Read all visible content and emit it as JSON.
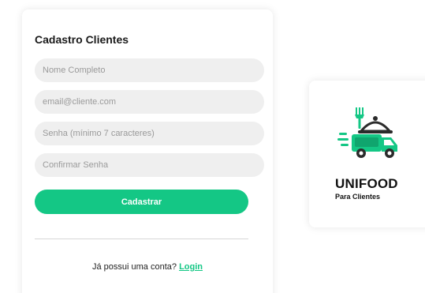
{
  "form": {
    "title": "Cadastro Clientes",
    "fields": {
      "name_placeholder": "Nome Completo",
      "email_placeholder": "email@cliente.com",
      "password_placeholder": "Senha (mínimo 7 caracteres)",
      "confirm_placeholder": "Confirmar Senha"
    },
    "submit_label": "Cadastrar",
    "login_prompt": "Já possui uma conta?",
    "login_link": "Login"
  },
  "brand": {
    "name": "UNIFOOD",
    "subtitle": "Para Clientes",
    "logo_icon": "delivery-truck-cloche-icon"
  },
  "colors": {
    "accent": "#14c785",
    "field_bg": "#efefef",
    "text": "#1a1a1a"
  }
}
